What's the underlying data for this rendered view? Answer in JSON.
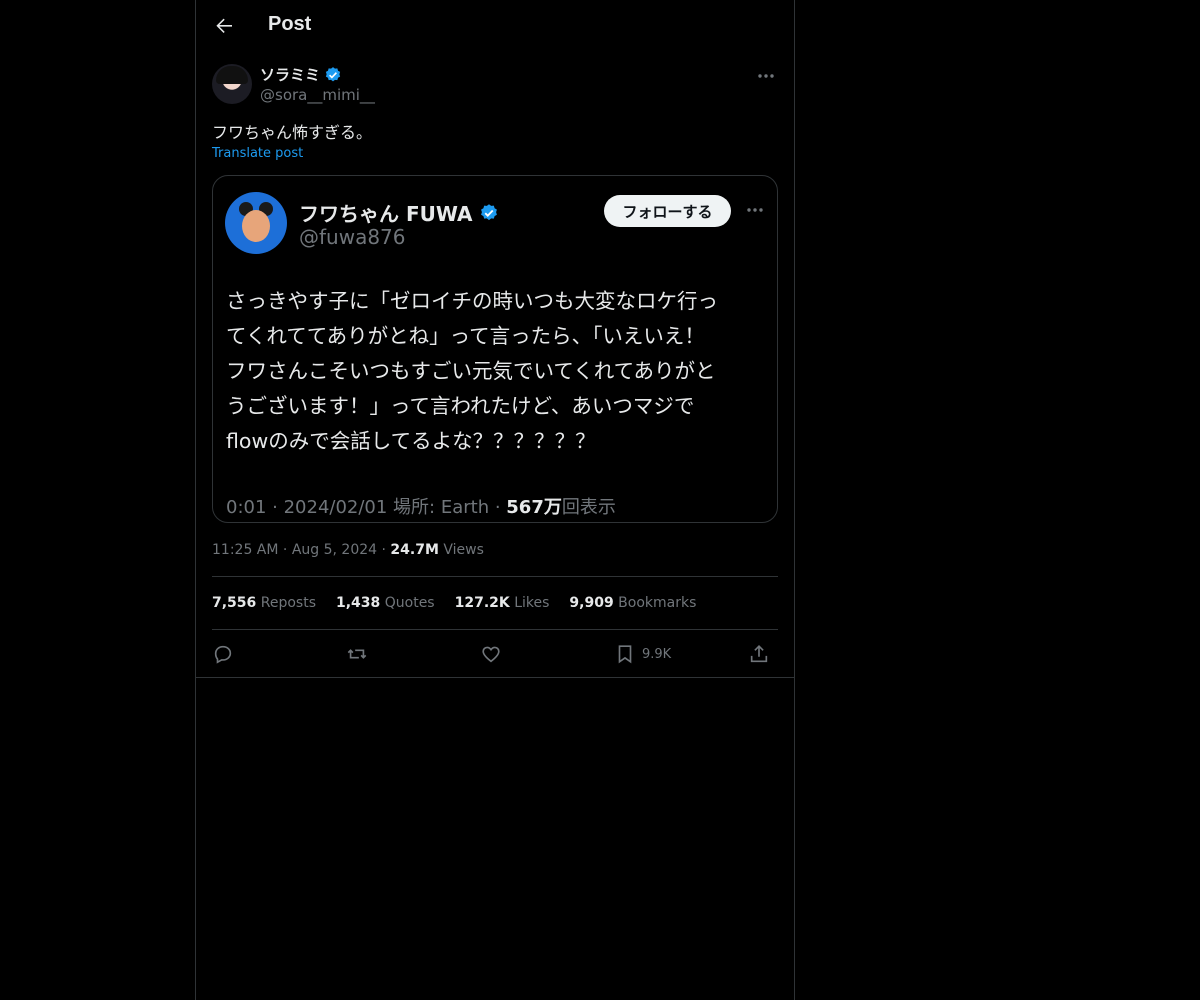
{
  "header": {
    "title": "Post"
  },
  "tweet": {
    "author": {
      "display_name": "ソラミミ",
      "handle": "@sora__mimi__"
    },
    "text": "フワちゃん怖すぎる。",
    "translate_label": "Translate post",
    "time": "11:25 AM",
    "date": "Aug 5, 2024",
    "views_count": "24.7M",
    "views_label": "Views"
  },
  "quoted": {
    "display_name": "フワちゃん FUWA",
    "handle": "@fuwa876",
    "follow_label": "フォローする",
    "lines": [
      "さっきやす子に「ゼロイチの時いつも大変なロケ行っ",
      "てくれててありがとね」って言ったら、「いえいえ！",
      "フワさんこそいつもすごい元気でいてくれてありがと",
      "うございます！」って言われたけど、あいつマジで",
      "flowのみで会話してるよな？？？？？？"
    ],
    "meta_prefix": "0:01 · 2024/02/01 場所: Earth · ",
    "view_count": "567万",
    "view_suffix": "回表示"
  },
  "stats": {
    "reposts_count": "7,556",
    "reposts_label": "Reposts",
    "quotes_count": "1,438",
    "quotes_label": "Quotes",
    "likes_count": "127.2K",
    "likes_label": "Likes",
    "bookmarks_count": "9,909",
    "bookmarks_label": "Bookmarks"
  },
  "actions": {
    "bookmark_count": "9.9K"
  },
  "icons": {
    "back": "arrow-left-icon",
    "more": "more-horizontal-icon",
    "verified": "verified-badge-icon",
    "reply": "reply-icon",
    "repost": "repost-icon",
    "like": "heart-icon",
    "bookmark": "bookmark-icon",
    "share": "share-icon"
  },
  "colors": {
    "background": "#000000",
    "accent": "#1d9bf0",
    "muted": "#71767b",
    "text": "#e7e9ea",
    "border": "#2f3336"
  }
}
